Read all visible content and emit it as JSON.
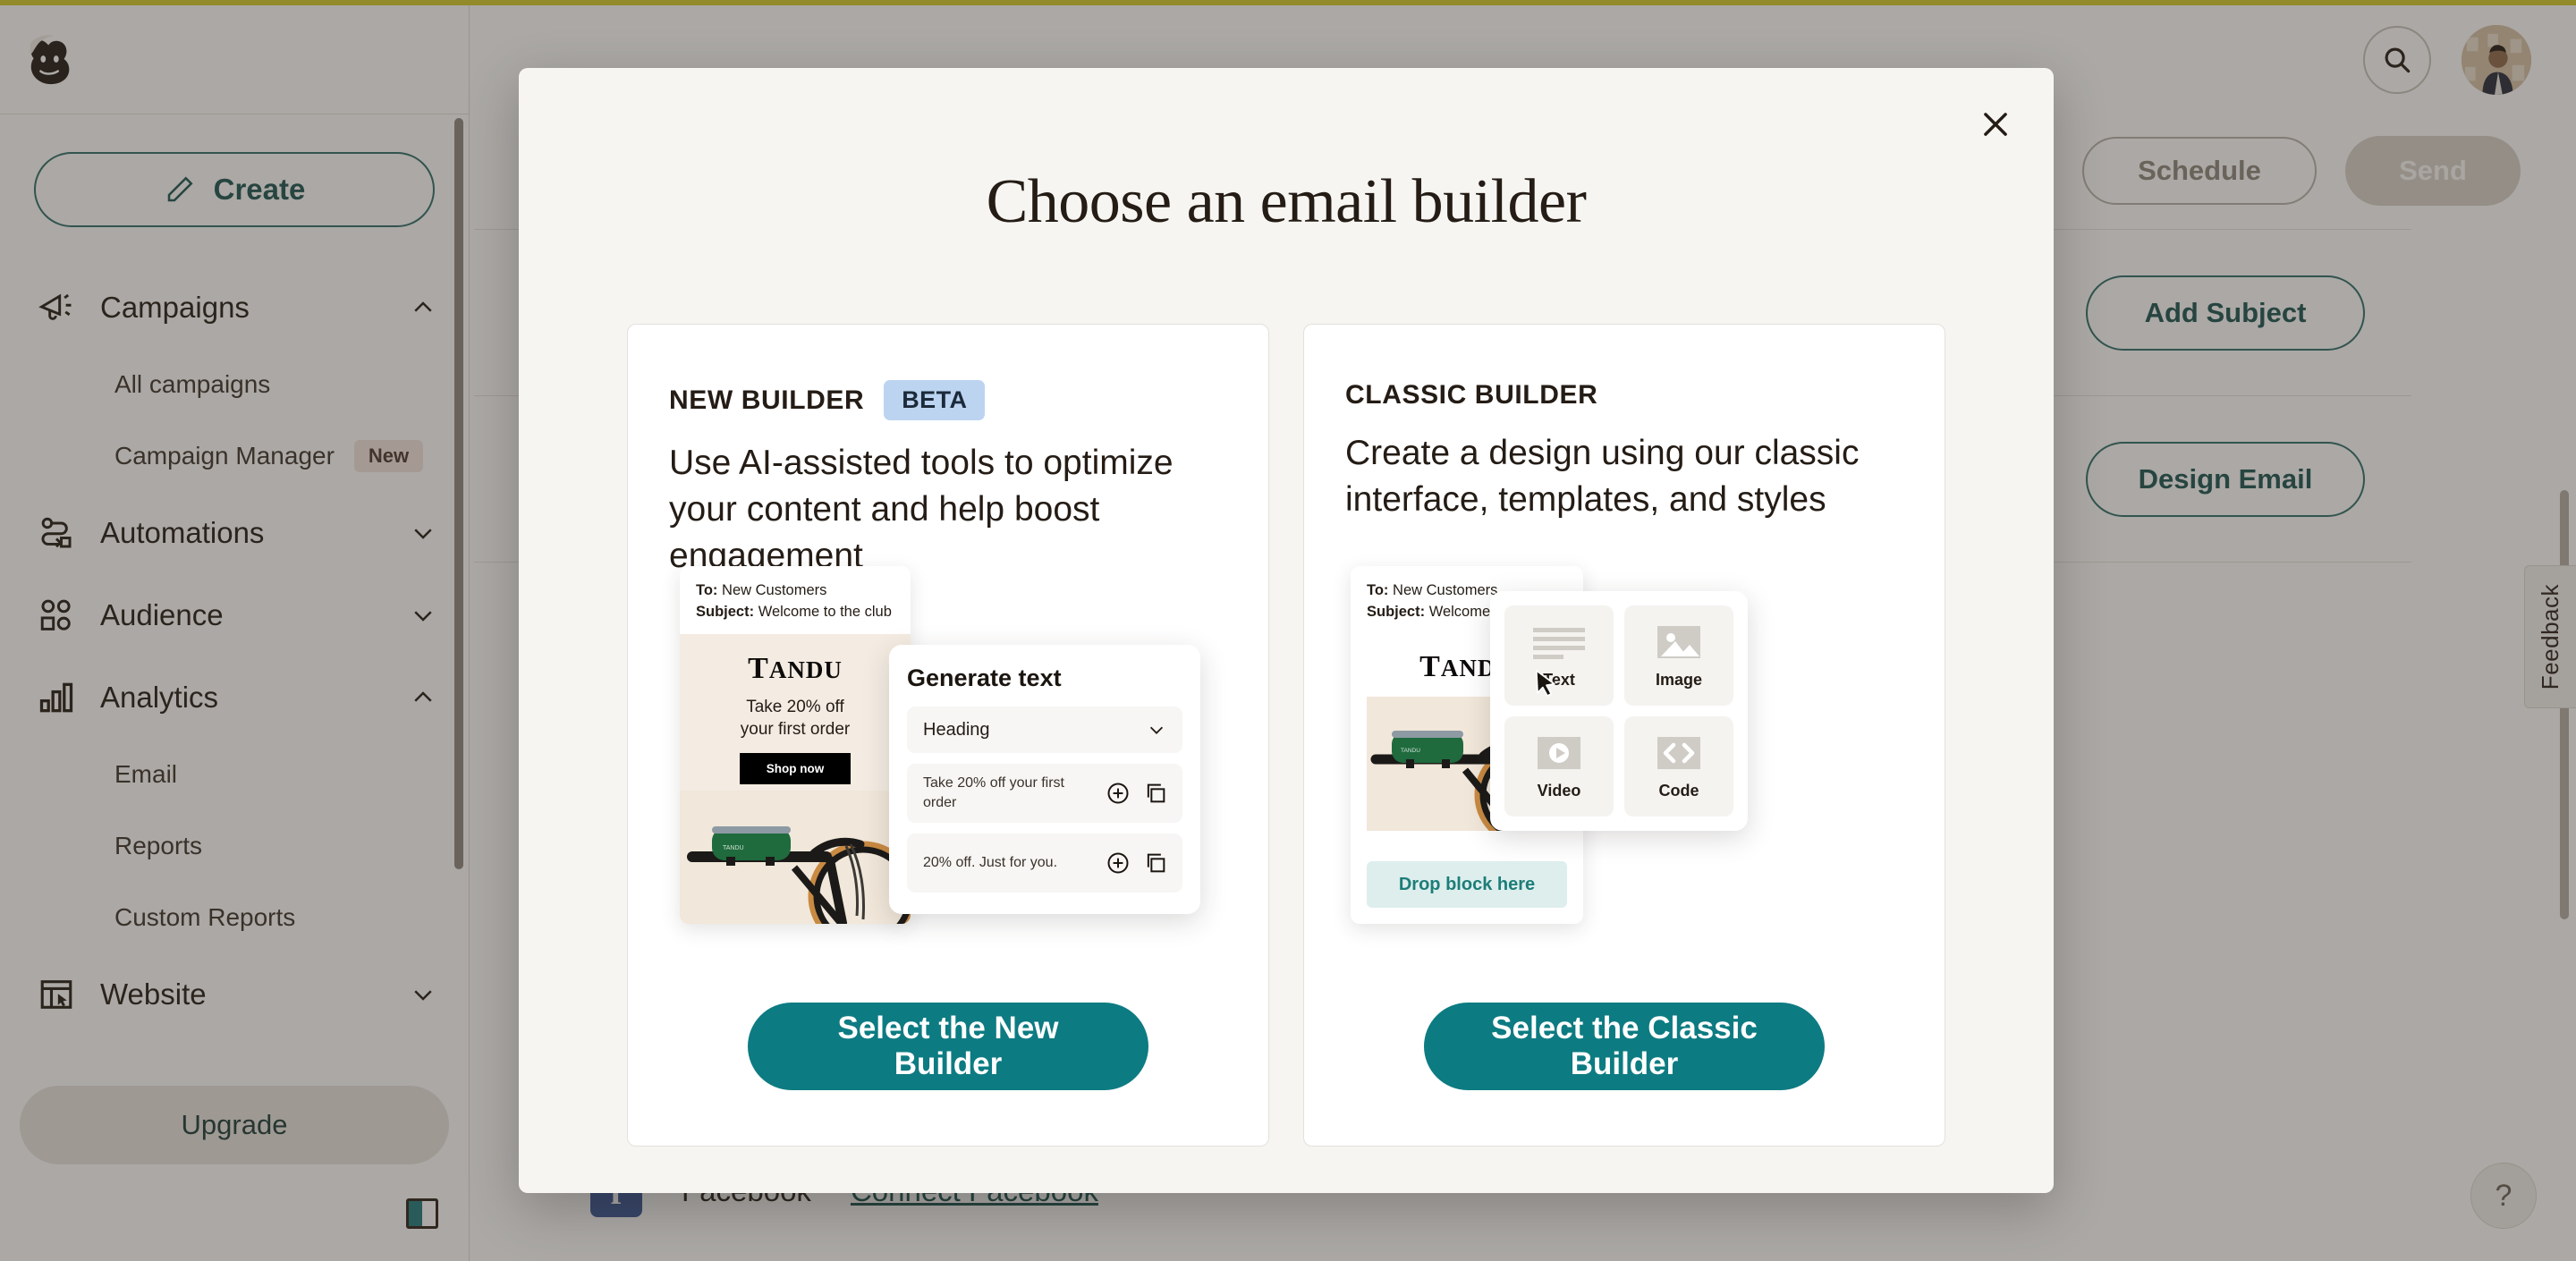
{
  "app": {
    "logo_icon": "mailchimp-freddie-logo",
    "accent_top_color": "#d6cb2f"
  },
  "header": {
    "search_icon": "search-icon",
    "avatar_label": "user-avatar"
  },
  "sidebar": {
    "create_button": "Create",
    "create_icon": "pencil-icon",
    "upgrade_button": "Upgrade",
    "panel_toggle_icon": "panel-toggle-icon",
    "groups": [
      {
        "label": "Campaigns",
        "icon": "megaphone-icon",
        "chevron": "chevron-up-icon",
        "expanded": true,
        "items": [
          {
            "label": "All campaigns",
            "badge": ""
          },
          {
            "label": "Campaign Manager",
            "badge": "New"
          }
        ]
      },
      {
        "label": "Automations",
        "icon": "automation-path-icon",
        "chevron": "chevron-down-icon",
        "expanded": false,
        "items": []
      },
      {
        "label": "Audience",
        "icon": "audience-people-icon",
        "chevron": "chevron-down-icon",
        "expanded": false,
        "items": []
      },
      {
        "label": "Analytics",
        "icon": "bar-chart-icon",
        "chevron": "chevron-up-icon",
        "expanded": true,
        "items": [
          {
            "label": "Email",
            "badge": ""
          },
          {
            "label": "Reports",
            "badge": ""
          },
          {
            "label": "Custom Reports",
            "badge": ""
          }
        ]
      },
      {
        "label": "Website",
        "icon": "website-cursor-icon",
        "chevron": "chevron-down-icon",
        "expanded": false,
        "items": []
      }
    ]
  },
  "background": {
    "schedule_button": "Schedule",
    "send_button": "Send",
    "add_subject_button": "Add Subject",
    "design_email_button": "Design Email",
    "facebook_name": "Facebook",
    "facebook_link": "Connect Facebook",
    "facebook_icon": "facebook-icon",
    "feedback_tab": "Feedback",
    "help_button": "?"
  },
  "modal": {
    "title": "Choose an email builder",
    "close_icon": "close-icon",
    "cards": [
      {
        "kicker": "NEW BUILDER",
        "badge": "BETA",
        "description": "Use AI-assisted tools to optimize your content and help boost engagement",
        "cta": "Select the New Builder",
        "illustration": {
          "type": "new-builder-illustration",
          "mail": {
            "to_label": "To:",
            "to_value": "New Customers",
            "subject_label": "Subject:",
            "subject_value": "Welcome to the club",
            "brand": "TANDU",
            "headline": "Take 20% off\nyour first order",
            "button": "Shop now"
          },
          "generate_panel": {
            "title": "Generate text",
            "select_value": "Heading",
            "select_icon": "chevron-down-icon",
            "suggestions": [
              {
                "text": "Take 20% off your first order",
                "add_icon": "plus-circle-icon",
                "copy_icon": "copy-icon"
              },
              {
                "text": "20% off. Just for you.",
                "add_icon": "plus-circle-icon",
                "copy_icon": "copy-icon"
              }
            ]
          }
        }
      },
      {
        "kicker": "CLASSIC BUILDER",
        "badge": "",
        "description": "Create a design using our classic interface, templates, and styles",
        "cta": "Select the Classic Builder",
        "illustration": {
          "type": "classic-builder-illustration",
          "mail": {
            "to_label": "To:",
            "to_value": "New Customers",
            "subject_label": "Subject:",
            "subject_value": "Welcome to the club",
            "brand": "TANDU",
            "drop_zone": "Drop block here"
          },
          "palette": [
            {
              "label": "Text",
              "icon": "text-lines-icon"
            },
            {
              "label": "Image",
              "icon": "image-icon"
            },
            {
              "label": "Video",
              "icon": "video-play-icon"
            },
            {
              "label": "Code",
              "icon": "code-brackets-icon"
            }
          ],
          "cursor_icon": "mouse-cursor-icon"
        }
      }
    ]
  },
  "colors": {
    "accent_teal": "#0d7b82",
    "link_teal": "#1d5552",
    "beta_badge_bg": "#bcd4f0",
    "brand_yellow": "#d6cb2f",
    "facebook_blue": "#3b5998"
  }
}
